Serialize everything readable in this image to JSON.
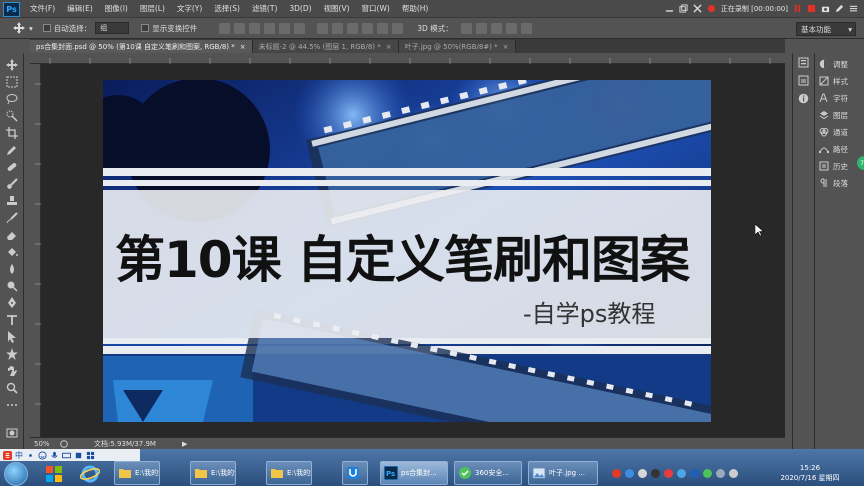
{
  "app": {
    "logo": "Ps"
  },
  "menu": [
    "文件(F)",
    "编辑(E)",
    "图像(I)",
    "图层(L)",
    "文字(Y)",
    "选择(S)",
    "滤镜(T)",
    "3D(D)",
    "视图(V)",
    "窗口(W)",
    "帮助(H)"
  ],
  "recorder": {
    "status": "正在录制 [00:00:00]"
  },
  "options": {
    "auto_select_label": "自动选择：",
    "auto_select_value": "组",
    "show_transform_label": "显示变换控件",
    "mode_3d_label": "3D 模式：",
    "workspace": "基本功能"
  },
  "tabs": [
    {
      "label": "ps合集封面.psd @ 50% (第10课  自定义笔刷和图案, RGB/8) *",
      "active": true
    },
    {
      "label": "未标题-2 @ 44.5% (图层 1, RGB/8) *",
      "active": false
    },
    {
      "label": "叶子.jpg @ 50%(RGB/8#) *",
      "active": false
    }
  ],
  "canvas": {
    "title": "第10课  自定义笔刷和图案",
    "subtitle": "-自学ps教程"
  },
  "status": {
    "zoom": "50%",
    "doc": "文档:5.93M/37.9M"
  },
  "panels": [
    "调整",
    "样式",
    "字符",
    "图层",
    "通道",
    "路径",
    "历史",
    "段落"
  ],
  "taskbar": {
    "ime": "中",
    "buttons": [
      {
        "label": "E:\\我的资...",
        "active": false
      },
      {
        "label": "E:\\我的资...",
        "active": false
      },
      {
        "label": "E:\\我的资...",
        "active": false
      },
      {
        "label": "",
        "active": false
      },
      {
        "label": "ps合集封...",
        "active": true
      },
      {
        "label": "360安全...",
        "active": false
      },
      {
        "label": "叶子.jpg ...",
        "active": false
      }
    ],
    "time": "15:26",
    "date": "2020/7/16 星期四"
  },
  "colors": {
    "foreground": "#2bb52b",
    "background": "#b31ecb",
    "ps_blue": "#31a8ff"
  }
}
